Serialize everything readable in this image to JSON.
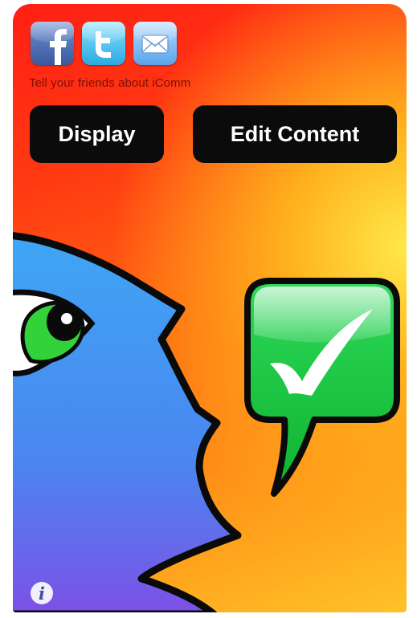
{
  "app": {
    "name": "iComm"
  },
  "share": {
    "buttons": [
      {
        "id": "facebook",
        "icon": "facebook-icon",
        "color": "#3b5a9e"
      },
      {
        "id": "twitter",
        "icon": "twitter-icon",
        "color": "#2aa9e0"
      },
      {
        "id": "email",
        "icon": "mail-icon",
        "color": "#5aa4ea"
      }
    ],
    "tagline": "Tell your friends about iComm"
  },
  "actions": {
    "display_label": "Display",
    "edit_label": "Edit Content"
  },
  "artwork": {
    "background_colors": [
      "#ff1f14",
      "#ff7a12",
      "#ffe94a"
    ],
    "face_color": "#3aa2f5",
    "bubble_color": "#14c53c",
    "bubble_icon": "checkmark-icon"
  },
  "info": {
    "icon": "info-icon"
  }
}
